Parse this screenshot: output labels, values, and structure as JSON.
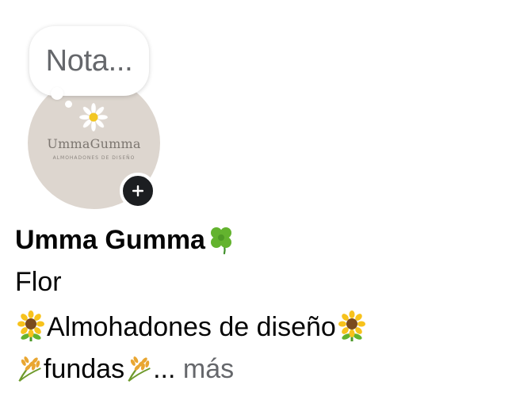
{
  "note": {
    "placeholder_text": "Nota..."
  },
  "avatar": {
    "brand_name": "UmmaGumma",
    "tagline": "ALMOHADONES DE DISEÑO",
    "background_color": "#ddd6cf"
  },
  "add_button": {
    "icon": "plus-icon"
  },
  "profile": {
    "name": "Umma Gumma",
    "name_emoji": "four-leaf-clover-icon"
  },
  "bio": {
    "line1": "Flor",
    "line2_text": "Almohadones de diseño",
    "line2_emoji": "sunflower-icon",
    "line3_text": "fundas",
    "line3_emoji": "wheat-icon",
    "ellipsis": "...",
    "more_label": "más"
  },
  "colors": {
    "primary_text": "#050505",
    "secondary_text": "#65676b",
    "button_dark": "#1c1e21"
  }
}
